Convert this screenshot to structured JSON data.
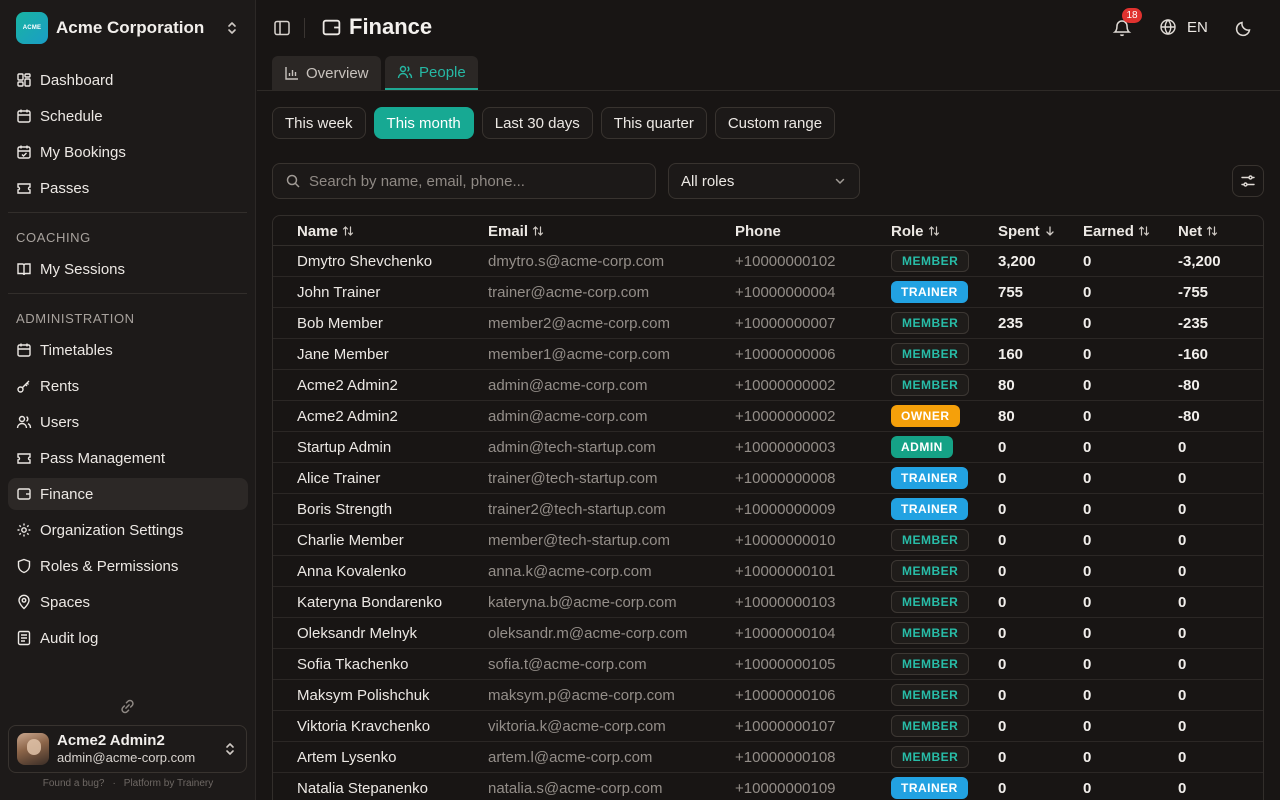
{
  "org": {
    "name": "Acme Corporation",
    "logo_text": "ACME"
  },
  "nav": {
    "main": [
      {
        "label": "Dashboard",
        "icon": "dashboard-icon"
      },
      {
        "label": "Schedule",
        "icon": "calendar-icon"
      },
      {
        "label": "My Bookings",
        "icon": "calendar-check-icon"
      },
      {
        "label": "Passes",
        "icon": "ticket-icon"
      }
    ],
    "coaching_title": "COACHING",
    "coaching": [
      {
        "label": "My Sessions",
        "icon": "book-icon"
      }
    ],
    "admin_title": "ADMINISTRATION",
    "admin": [
      {
        "label": "Timetables",
        "icon": "calendar-icon"
      },
      {
        "label": "Rents",
        "icon": "key-icon"
      },
      {
        "label": "Users",
        "icon": "users-icon"
      },
      {
        "label": "Pass Management",
        "icon": "ticket-icon"
      },
      {
        "label": "Finance",
        "icon": "wallet-icon"
      },
      {
        "label": "Organization Settings",
        "icon": "gear-icon"
      },
      {
        "label": "Roles & Permissions",
        "icon": "shield-icon"
      },
      {
        "label": "Spaces",
        "icon": "map-pin-icon"
      },
      {
        "label": "Audit log",
        "icon": "document-list-icon"
      }
    ]
  },
  "user": {
    "name": "Acme2 Admin2",
    "email": "admin@acme-corp.com"
  },
  "footer": {
    "bug": "Found a bug?",
    "sep": "·",
    "platform": "Platform by Trainery"
  },
  "header": {
    "title": "Finance",
    "notifications": "18",
    "language": "EN"
  },
  "tabs": [
    {
      "label": "Overview",
      "icon": "bar-chart-icon",
      "active": false
    },
    {
      "label": "People",
      "icon": "users-icon",
      "active": true
    }
  ],
  "ranges": [
    {
      "label": "This week",
      "active": false
    },
    {
      "label": "This month",
      "active": true
    },
    {
      "label": "Last 30 days",
      "active": false
    },
    {
      "label": "This quarter",
      "active": false
    },
    {
      "label": "Custom range",
      "active": false
    }
  ],
  "search": {
    "placeholder": "Search by name, email, phone..."
  },
  "role_filter": {
    "value": "All roles"
  },
  "table": {
    "columns": {
      "name": "Name",
      "email": "Email",
      "phone": "Phone",
      "role": "Role",
      "spent": "Spent",
      "earned": "Earned",
      "net": "Net"
    },
    "rows": [
      {
        "name": "Dmytro Shevchenko",
        "email": "dmytro.s@acme-corp.com",
        "phone": "+10000000102",
        "role": "MEMBER",
        "spent": "3,200",
        "earned": "0",
        "net": "-3,200"
      },
      {
        "name": "John Trainer",
        "email": "trainer@acme-corp.com",
        "phone": "+10000000004",
        "role": "TRAINER",
        "spent": "755",
        "earned": "0",
        "net": "-755"
      },
      {
        "name": "Bob Member",
        "email": "member2@acme-corp.com",
        "phone": "+10000000007",
        "role": "MEMBER",
        "spent": "235",
        "earned": "0",
        "net": "-235"
      },
      {
        "name": "Jane Member",
        "email": "member1@acme-corp.com",
        "phone": "+10000000006",
        "role": "MEMBER",
        "spent": "160",
        "earned": "0",
        "net": "-160"
      },
      {
        "name": "Acme2 Admin2",
        "email": "admin@acme-corp.com",
        "phone": "+10000000002",
        "role": "MEMBER",
        "spent": "80",
        "earned": "0",
        "net": "-80"
      },
      {
        "name": "Acme2 Admin2",
        "email": "admin@acme-corp.com",
        "phone": "+10000000002",
        "role": "OWNER",
        "spent": "80",
        "earned": "0",
        "net": "-80"
      },
      {
        "name": "Startup Admin",
        "email": "admin@tech-startup.com",
        "phone": "+10000000003",
        "role": "ADMIN",
        "spent": "0",
        "earned": "0",
        "net": "0"
      },
      {
        "name": "Alice Trainer",
        "email": "trainer@tech-startup.com",
        "phone": "+10000000008",
        "role": "TRAINER",
        "spent": "0",
        "earned": "0",
        "net": "0"
      },
      {
        "name": "Boris Strength",
        "email": "trainer2@tech-startup.com",
        "phone": "+10000000009",
        "role": "TRAINER",
        "spent": "0",
        "earned": "0",
        "net": "0"
      },
      {
        "name": "Charlie Member",
        "email": "member@tech-startup.com",
        "phone": "+10000000010",
        "role": "MEMBER",
        "spent": "0",
        "earned": "0",
        "net": "0"
      },
      {
        "name": "Anna Kovalenko",
        "email": "anna.k@acme-corp.com",
        "phone": "+10000000101",
        "role": "MEMBER",
        "spent": "0",
        "earned": "0",
        "net": "0"
      },
      {
        "name": "Kateryna Bondarenko",
        "email": "kateryna.b@acme-corp.com",
        "phone": "+10000000103",
        "role": "MEMBER",
        "spent": "0",
        "earned": "0",
        "net": "0"
      },
      {
        "name": "Oleksandr Melnyk",
        "email": "oleksandr.m@acme-corp.com",
        "phone": "+10000000104",
        "role": "MEMBER",
        "spent": "0",
        "earned": "0",
        "net": "0"
      },
      {
        "name": "Sofia Tkachenko",
        "email": "sofia.t@acme-corp.com",
        "phone": "+10000000105",
        "role": "MEMBER",
        "spent": "0",
        "earned": "0",
        "net": "0"
      },
      {
        "name": "Maksym Polishchuk",
        "email": "maksym.p@acme-corp.com",
        "phone": "+10000000106",
        "role": "MEMBER",
        "spent": "0",
        "earned": "0",
        "net": "0"
      },
      {
        "name": "Viktoria Kravchenko",
        "email": "viktoria.k@acme-corp.com",
        "phone": "+10000000107",
        "role": "MEMBER",
        "spent": "0",
        "earned": "0",
        "net": "0"
      },
      {
        "name": "Artem Lysenko",
        "email": "artem.l@acme-corp.com",
        "phone": "+10000000108",
        "role": "MEMBER",
        "spent": "0",
        "earned": "0",
        "net": "0"
      },
      {
        "name": "Natalia Stepanenko",
        "email": "natalia.s@acme-corp.com",
        "phone": "+10000000109",
        "role": "TRAINER",
        "spent": "0",
        "earned": "0",
        "net": "0"
      }
    ]
  },
  "colors": {
    "accent": "#17a993",
    "trainer": "#22a2e2",
    "owner": "#f5a00a",
    "admin": "#15a286",
    "notification": "#e0322f"
  }
}
